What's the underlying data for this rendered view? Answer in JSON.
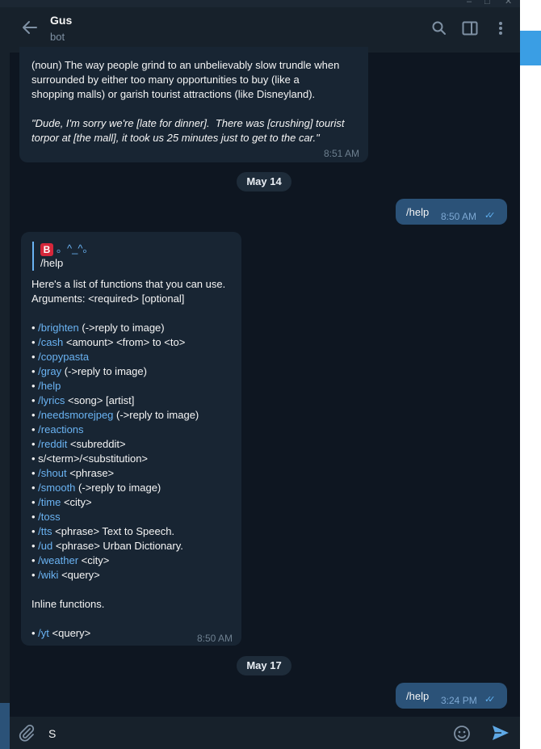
{
  "window": {
    "controls": [
      "–",
      "□",
      "✕"
    ]
  },
  "header": {
    "name": "Gus",
    "subtitle": "bot",
    "icons": [
      "back-arrow-icon",
      "search-icon",
      "sidebar-toggle-icon",
      "more-vert-icon"
    ]
  },
  "messages": {
    "m1": {
      "line1": "(noun) The way people grind to an unbelievably slow trundle when",
      "line2": "surrounded by either too many opportunities to buy (like a",
      "line3": "shopping malls) or garish tourist attractions (like Disneyland).",
      "quote1": "\"Dude, I'm sorry we're [late for dinner].  There was [crushing] tourist",
      "quote2": "torpor at [the mall], it took us 25 minutes just to get to the car.\"",
      "time": "8:51 AM"
    },
    "date1": "May 14",
    "out1": {
      "text": "/help",
      "time": "8:50 AM"
    },
    "bot": {
      "reply_author": "。^_^。",
      "reply_badge": "B",
      "reply_text": "/help",
      "intro1": "Here's a list of functions that you can use.",
      "intro2": "Arguments: <required> [optional]",
      "commands": [
        {
          "cmd": "/brighten",
          "args": " (->reply to image)"
        },
        {
          "cmd": "/cash",
          "args": " <amount> <from> to <to>"
        },
        {
          "cmd": "/copypasta",
          "args": ""
        },
        {
          "cmd": "/gray",
          "args": " (->reply to image)"
        },
        {
          "cmd": "/help",
          "args": ""
        },
        {
          "cmd": "/lyrics",
          "args": " <song> [artist]"
        },
        {
          "cmd": "/needsmorejpeg",
          "args": " (->reply to image)"
        },
        {
          "cmd": "/reactions",
          "args": ""
        },
        {
          "cmd": "/reddit",
          "args": " <subreddit>"
        },
        {
          "cmd": "",
          "args": "s/<term>/<substitution>"
        },
        {
          "cmd": "/shout",
          "args": " <phrase>"
        },
        {
          "cmd": "/smooth",
          "args": " (->reply to image)"
        },
        {
          "cmd": "/time",
          "args": " <city>"
        },
        {
          "cmd": "/toss",
          "args": ""
        },
        {
          "cmd": "/tts",
          "args": " <phrase> Text to Speech."
        },
        {
          "cmd": "/ud",
          "args": " <phrase> Urban Dictionary."
        },
        {
          "cmd": "/weather",
          "args": " <city>"
        },
        {
          "cmd": "/wiki",
          "args": " <query>"
        }
      ],
      "inline_title": "Inline functions.",
      "inline_cmd": "/yt",
      "inline_args": " <query>",
      "bullet": "• ",
      "time": "8:50 AM"
    },
    "date2": "May 17",
    "out2": {
      "text": "/help",
      "time": "3:24 PM"
    }
  },
  "composer": {
    "value": "S",
    "icons": [
      "attach-icon",
      "emoji-icon",
      "send-icon"
    ]
  },
  "colors": {
    "background": "#0e1621",
    "panel": "#17212b",
    "incoming": "#182533",
    "outgoing": "#2b5278",
    "link": "#6ab3f3"
  }
}
